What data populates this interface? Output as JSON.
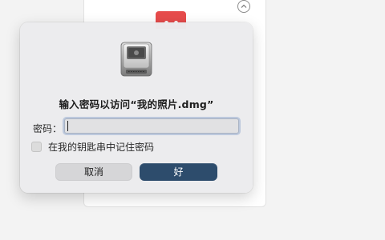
{
  "dialog": {
    "title": "输入密码以访问“我的照片.dmg”",
    "password_label": "密码：",
    "password_value": "",
    "remember_label": "在我的钥匙串中记住密码",
    "remember_checked": false,
    "cancel_label": "取消",
    "ok_label": "好",
    "icon": "disk-image-icon"
  },
  "background": {
    "app_icon": "calendar-app-icon",
    "collapse_icon": "chevron-up-icon"
  },
  "colors": {
    "ok_button": "#2d4c6c",
    "cancel_button": "#d6d6d8",
    "focus_ring": "#688abe"
  }
}
